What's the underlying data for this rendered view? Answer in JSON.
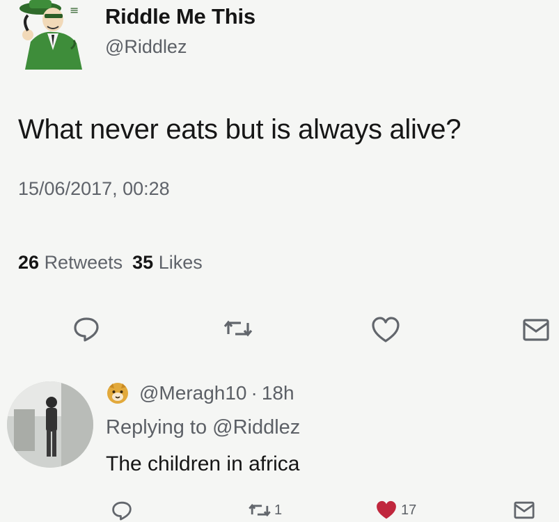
{
  "tweet": {
    "author_name": "Riddle Me This",
    "author_handle": "@Riddlez",
    "text": "What never eats but is always alive?",
    "timestamp": "15/06/2017, 00:28",
    "retweets_count": "26",
    "retweets_label": "Retweets",
    "likes_count": "35",
    "likes_label": "Likes"
  },
  "actions": {
    "icons": [
      "reply-icon",
      "retweet-icon",
      "like-icon",
      "message-icon"
    ]
  },
  "reply": {
    "handle": "@Meragh10",
    "separator": "·",
    "age": "18h",
    "replying_prefix": "Replying to",
    "replying_to": "@Riddlez",
    "text": "The children in africa",
    "retweets": "1",
    "likes": "17"
  },
  "colors": {
    "background": "#f5f6f4",
    "text": "#141414",
    "muted": "#5f636a",
    "like_red": "#c0273d",
    "avatar_green": "#3e8d3a"
  }
}
